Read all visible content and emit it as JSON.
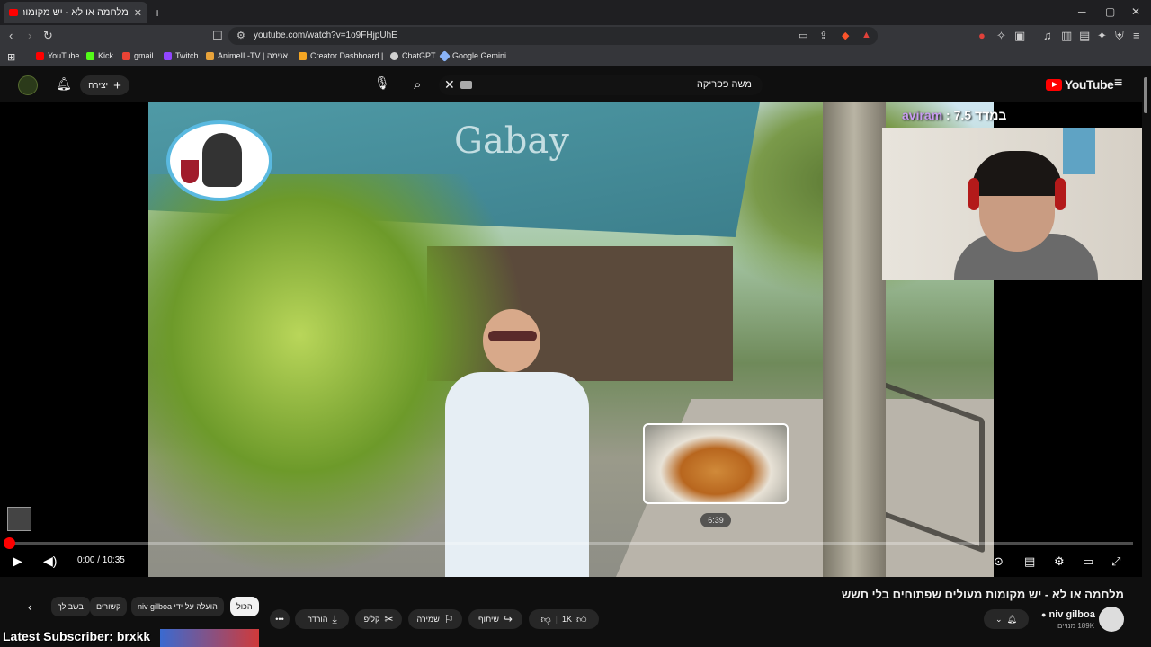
{
  "browser": {
    "tab_title": "מלחמה או לא - יש מקומות מעולי",
    "url": "youtube.com/watch?v=1o9FHjpUhE",
    "bookmarks": [
      {
        "label": "YouTube",
        "color": "#ff0000"
      },
      {
        "label": "Kick",
        "color": "#53fc18"
      },
      {
        "label": "gmail",
        "color": "#ea4335"
      },
      {
        "label": "Twitch",
        "color": "#9146ff"
      },
      {
        "label": "AnimeIL-TV | אנימה...",
        "color": "#e8a33a"
      },
      {
        "label": "Creator Dashboard |...",
        "color": "#f5a623"
      },
      {
        "label": "ChatGPT",
        "color": "#d0d0d0"
      },
      {
        "label": "Google Gemini",
        "color": "#8ab4f8"
      }
    ]
  },
  "youtube": {
    "logo_text": "YouTube",
    "search_query": "משה פפריקה",
    "create_label": "יצירה",
    "accent": "#ff0000"
  },
  "player": {
    "current_time": "0:00",
    "duration": "10:35",
    "time_readout": "0:00 / 10:35",
    "hover_time": "6:39",
    "progress_fraction": 0.0,
    "overlay": {
      "prefix": "במדד",
      "score": "7.5",
      "name": "aviram"
    }
  },
  "video": {
    "title": "מלחמה או לא - יש מקומות מעולים שפתוחים בלי חשש",
    "channel": "niv gilboa",
    "subscribers": "189K מנויים",
    "like_count": "1K",
    "actions": {
      "share": "שיתוף",
      "save": "שמירה",
      "clip": "קליפ",
      "download": "הורדה"
    }
  },
  "chips": {
    "all": "הכול",
    "uploaded_by": "הועלה על ידי niv gilboa",
    "related": "קשורים",
    "for_you": "בשבילך"
  },
  "stream_overlay": {
    "latest_subscriber": "Latest Subscriber: brxkk"
  }
}
